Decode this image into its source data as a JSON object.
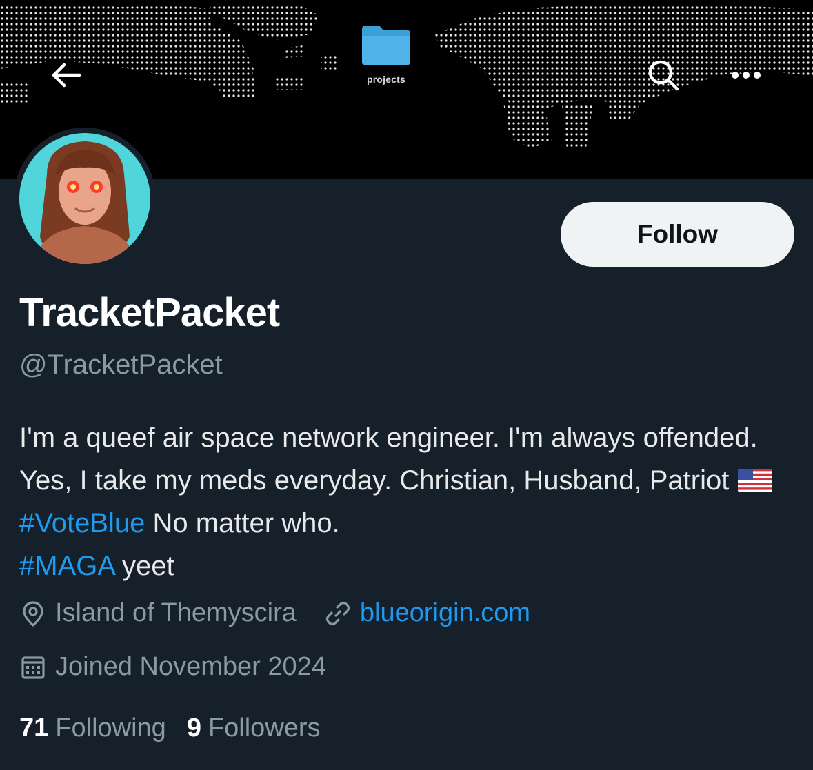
{
  "header": {
    "folder_label": "projects"
  },
  "profile": {
    "display_name": "TracketPacket",
    "handle": "@TracketPacket",
    "follow_label": "Follow",
    "bio": {
      "part1": "I'm a queef air space network engineer. I'm always offended. Yes, I take my meds everyday. Christian, Husband, Patriot ",
      "hashtag1": "#VoteBlue",
      "part2": " No matter who.",
      "hashtag2": "#MAGA",
      "part3": " yeet"
    },
    "location": "Island of Themyscira",
    "website": "blueorigin.com",
    "joined": "Joined November 2024",
    "following_count": "71",
    "following_label": "Following",
    "followers_count": "9",
    "followers_label": "Followers"
  },
  "icons": {
    "back": "arrow-left-icon",
    "search": "search-icon",
    "more": "more-icon",
    "folder": "folder-icon",
    "location": "location-pin-icon",
    "link": "link-icon",
    "calendar": "calendar-icon",
    "flag": "us-flag-icon"
  },
  "colors": {
    "background": "#15202b",
    "banner": "#000000",
    "accent": "#1d9bf0",
    "muted": "#8b98a5",
    "button_bg": "#eff3f4"
  }
}
